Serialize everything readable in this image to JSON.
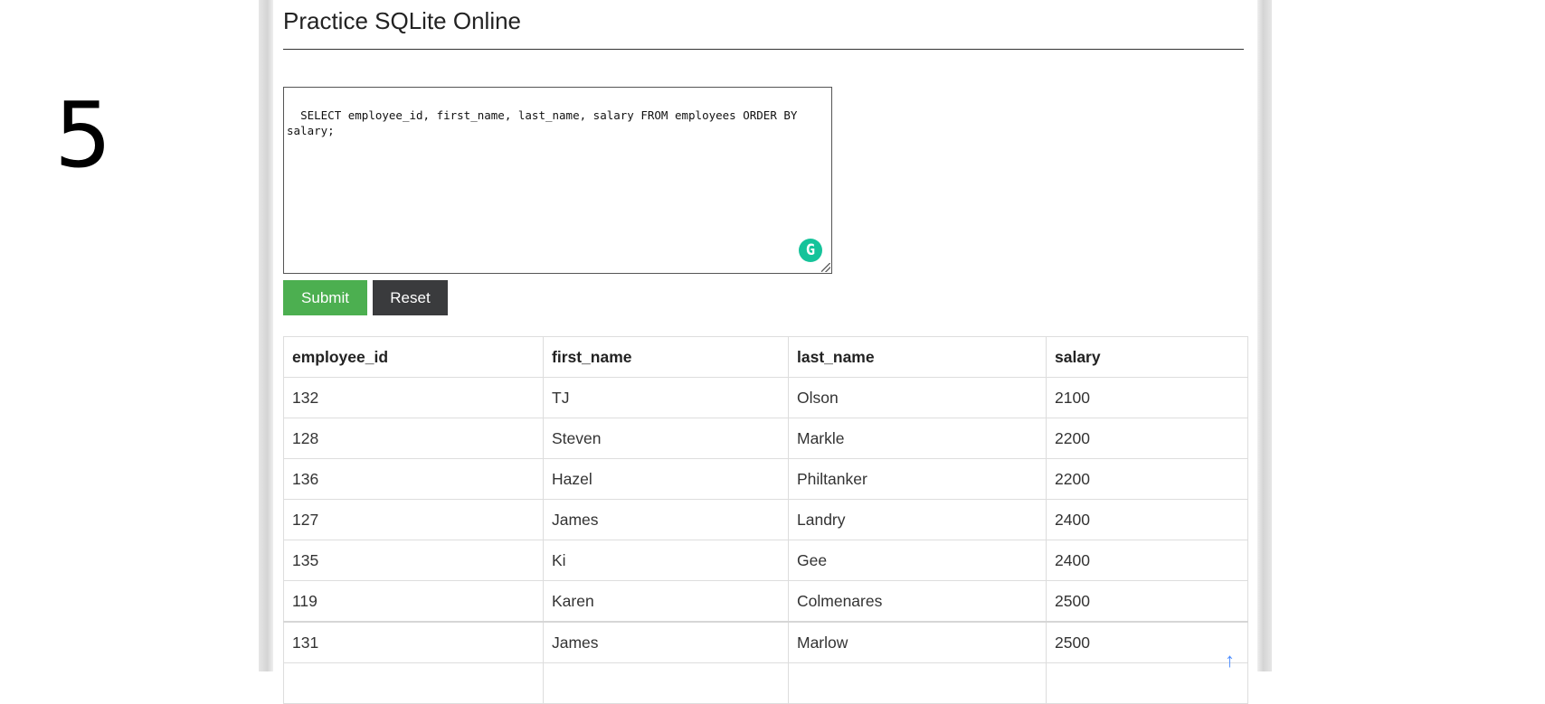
{
  "step_number": "5",
  "page": {
    "title": "Practice SQLite Online"
  },
  "editor": {
    "query": "SELECT employee_id, first_name, last_name, salary FROM employees ORDER BY salary;",
    "grammarly_icon": "G"
  },
  "buttons": {
    "submit": "Submit",
    "reset": "Reset"
  },
  "colors": {
    "submit": "#4caf50",
    "reset": "#3a3b3d",
    "grammarly": "#15c39a",
    "scroll_top": "#4a8cff"
  },
  "table": {
    "columns": [
      "employee_id",
      "first_name",
      "last_name",
      "salary"
    ],
    "rows": [
      [
        "132",
        "TJ",
        "Olson",
        "2100"
      ],
      [
        "128",
        "Steven",
        "Markle",
        "2200"
      ],
      [
        "136",
        "Hazel",
        "Philtanker",
        "2200"
      ],
      [
        "127",
        "James",
        "Landry",
        "2400"
      ],
      [
        "135",
        "Ki",
        "Gee",
        "2400"
      ],
      [
        "119",
        "Karen",
        "Colmenares",
        "2500"
      ],
      [
        "131",
        "James",
        "Marlow",
        "2500"
      ]
    ]
  },
  "scroll_top_icon": "↑"
}
